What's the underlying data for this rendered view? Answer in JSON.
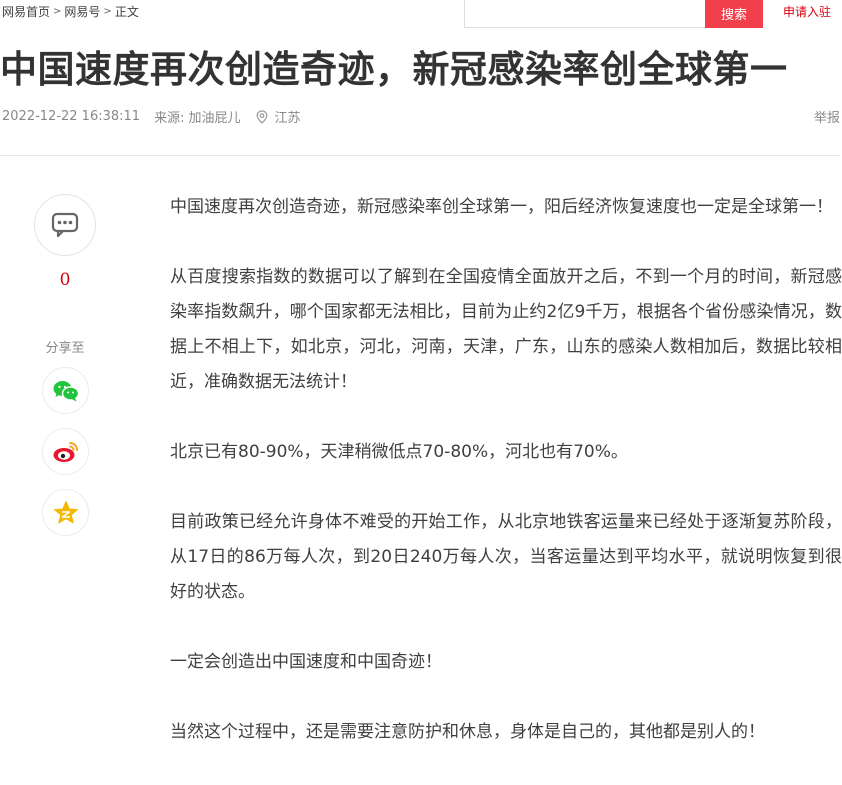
{
  "breadcrumb": {
    "items": [
      "网易首页",
      "网易号",
      "正文"
    ],
    "separator": ">"
  },
  "search": {
    "placeholder": "",
    "button_label": "搜索"
  },
  "header": {
    "apply_label": "申请入驻"
  },
  "article": {
    "title": "中国速度再次创造奇迹，新冠感染率创全球第一",
    "date": "2022-12-22 16:38:11",
    "source_label": "来源:",
    "source_name": "加油屁儿",
    "location": "江苏",
    "report_label": "举报",
    "paragraphs": [
      "中国速度再次创造奇迹，新冠感染率创全球第一，阳后经济恢复速度也一定是全球第一！",
      "从百度搜索指数的数据可以了解到在全国疫情全面放开之后，不到一个月的时间，新冠感染率指数飙升，哪个国家都无法相比，目前为止约2亿9千万，根据各个省份感染情况，数据上不相上下，如北京，河北，河南，天津，广东，山东的感染人数相加后，数据比较相近，准确数据无法统计！",
      "北京已有80-90%，天津稍微低点70-80%，河北也有70%。",
      "目前政策已经允许身体不难受的开始工作，从北京地铁客运量来已经处于逐渐复苏阶段，从17日的86万每人次，到20日240万每人次，当客运量达到平均水平，就说明恢复到很好的状态。",
      "一定会创造出中国速度和中国奇迹！",
      "当然这个过程中，还是需要注意防护和休息，身体是自己的，其他都是别人的！"
    ]
  },
  "sidebar": {
    "comment_icon": "comment-bubble-icon",
    "comment_count": "0",
    "share_label": "分享至",
    "share_icons": [
      "wechat-icon",
      "weibo-icon",
      "qzone-icon"
    ]
  },
  "colors": {
    "accent": "#d7000f",
    "search_button": "#f1404b",
    "wechat": "#20c33c",
    "weibo": "#e6162d",
    "qzone": "#f5b800"
  }
}
